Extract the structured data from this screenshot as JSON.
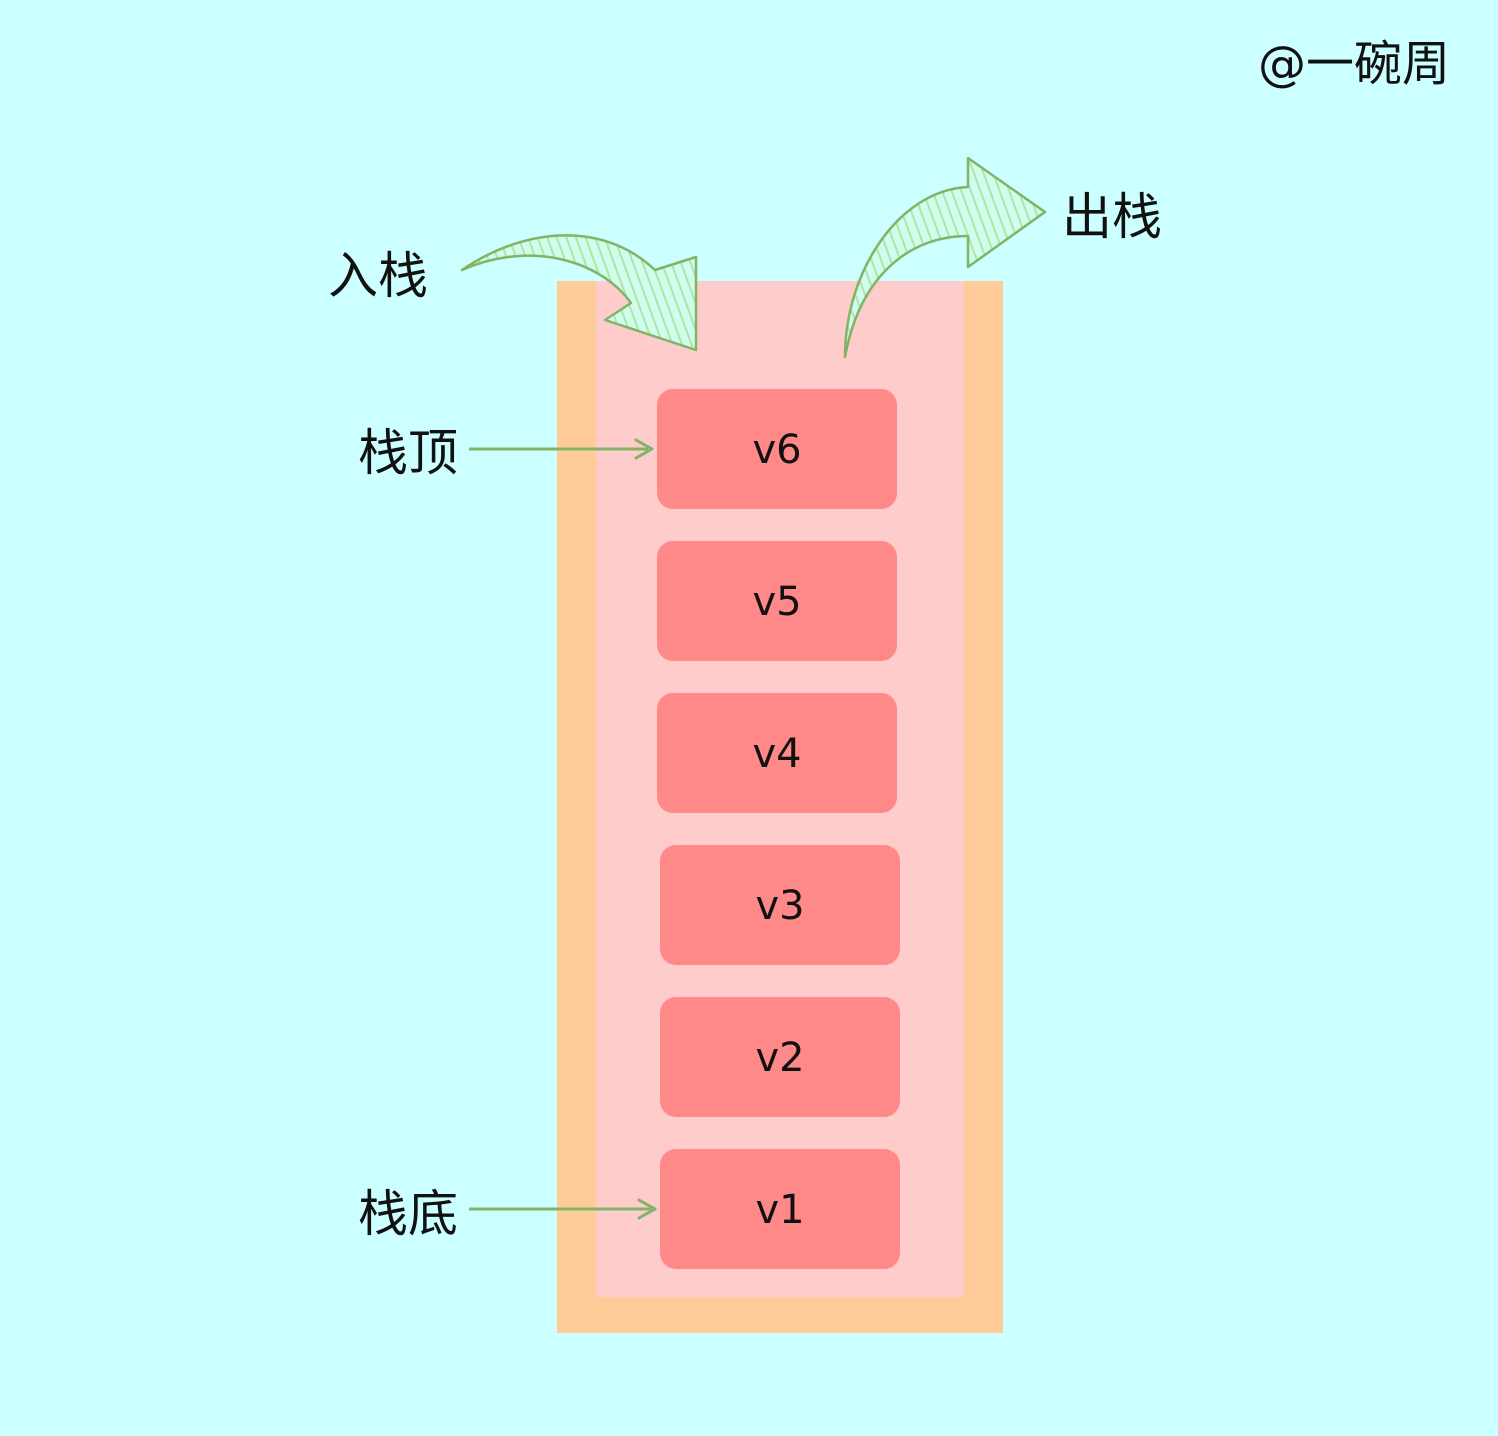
{
  "watermark": "@一碗周",
  "labels": {
    "push": "入栈",
    "pop": "出栈",
    "top": "栈顶",
    "bottom": "栈底"
  },
  "stack": {
    "items": [
      "v6",
      "v5",
      "v4",
      "v3",
      "v2",
      "v1"
    ]
  },
  "colors": {
    "background": "#ccffff",
    "container_border": "#ffcc99",
    "container_inner": "#ffcccc",
    "item_fill": "#ff8888",
    "arrow": "#82b366",
    "arrow_hatch": "#b9e0a5"
  }
}
